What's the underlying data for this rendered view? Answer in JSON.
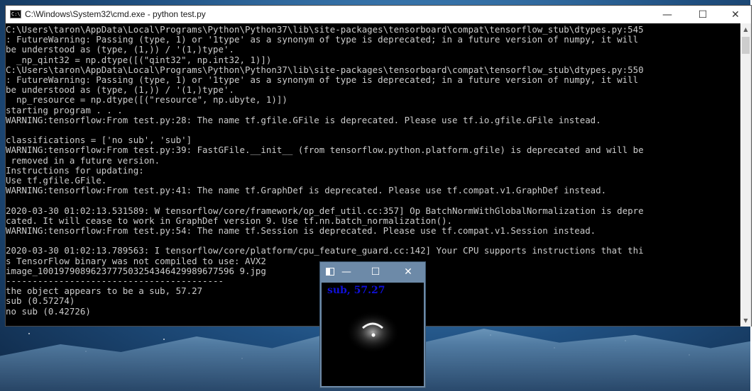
{
  "cmd_window": {
    "title": "C:\\Windows\\System32\\cmd.exe - python  test.py",
    "icon_label": "C:\\",
    "controls": {
      "minimize": "—",
      "maximize": "☐",
      "close": "✕"
    },
    "text_color": "#cccccc",
    "background_color": "#000000",
    "lines": [
      "C:\\Users\\taron\\AppData\\Local\\Programs\\Python\\Python37\\lib\\site-packages\\tensorboard\\compat\\tensorflow_stub\\dtypes.py:545",
      ": FutureWarning: Passing (type, 1) or '1type' as a synonym of type is deprecated; in a future version of numpy, it will",
      "be understood as (type, (1,)) / '(1,)type'.",
      "  _np_qint32 = np.dtype([(\"qint32\", np.int32, 1)])",
      "C:\\Users\\taron\\AppData\\Local\\Programs\\Python\\Python37\\lib\\site-packages\\tensorboard\\compat\\tensorflow_stub\\dtypes.py:550",
      ": FutureWarning: Passing (type, 1) or '1type' as a synonym of type is deprecated; in a future version of numpy, it will",
      "be understood as (type, (1,)) / '(1,)type'.",
      "  np_resource = np.dtype([(\"resource\", np.ubyte, 1)])",
      "starting program . . .",
      "WARNING:tensorflow:From test.py:28: The name tf.gfile.GFile is deprecated. Please use tf.io.gfile.GFile instead.",
      "",
      "classifications = ['no sub', 'sub']",
      "WARNING:tensorflow:From test.py:39: FastGFile.__init__ (from tensorflow.python.platform.gfile) is deprecated and will be",
      " removed in a future version.",
      "Instructions for updating:",
      "Use tf.gfile.GFile.",
      "WARNING:tensorflow:From test.py:41: The name tf.GraphDef is deprecated. Please use tf.compat.v1.GraphDef instead.",
      "",
      "2020-03-30 01:02:13.531589: W tensorflow/core/framework/op_def_util.cc:357] Op BatchNormWithGlobalNormalization is depre",
      "cated. It will cease to work in GraphDef version 9. Use tf.nn.batch_normalization().",
      "WARNING:tensorflow:From test.py:54: The name tf.Session is deprecated. Please use tf.compat.v1.Session instead.",
      "",
      "2020-03-30 01:02:13.789563: I tensorflow/core/platform/cpu_feature_guard.cc:142] Your CPU supports instructions that thi",
      "s TensorFlow binary was not compiled to use: AVX2",
      "image_1001979089623777503254346429989677596 9.jpg",
      "-----------------------------------------",
      "the object appears to be a sub, 57.27",
      "sub (0.57274)",
      "no sub (0.42726)"
    ]
  },
  "image_window": {
    "controls": {
      "minimize": "—",
      "maximize": "☐",
      "close": "✕"
    },
    "caption": "sub, 57.27",
    "caption_color": "#1010d8"
  },
  "scrollbar": {
    "up_arrow": "▲",
    "down_arrow": "▼"
  }
}
